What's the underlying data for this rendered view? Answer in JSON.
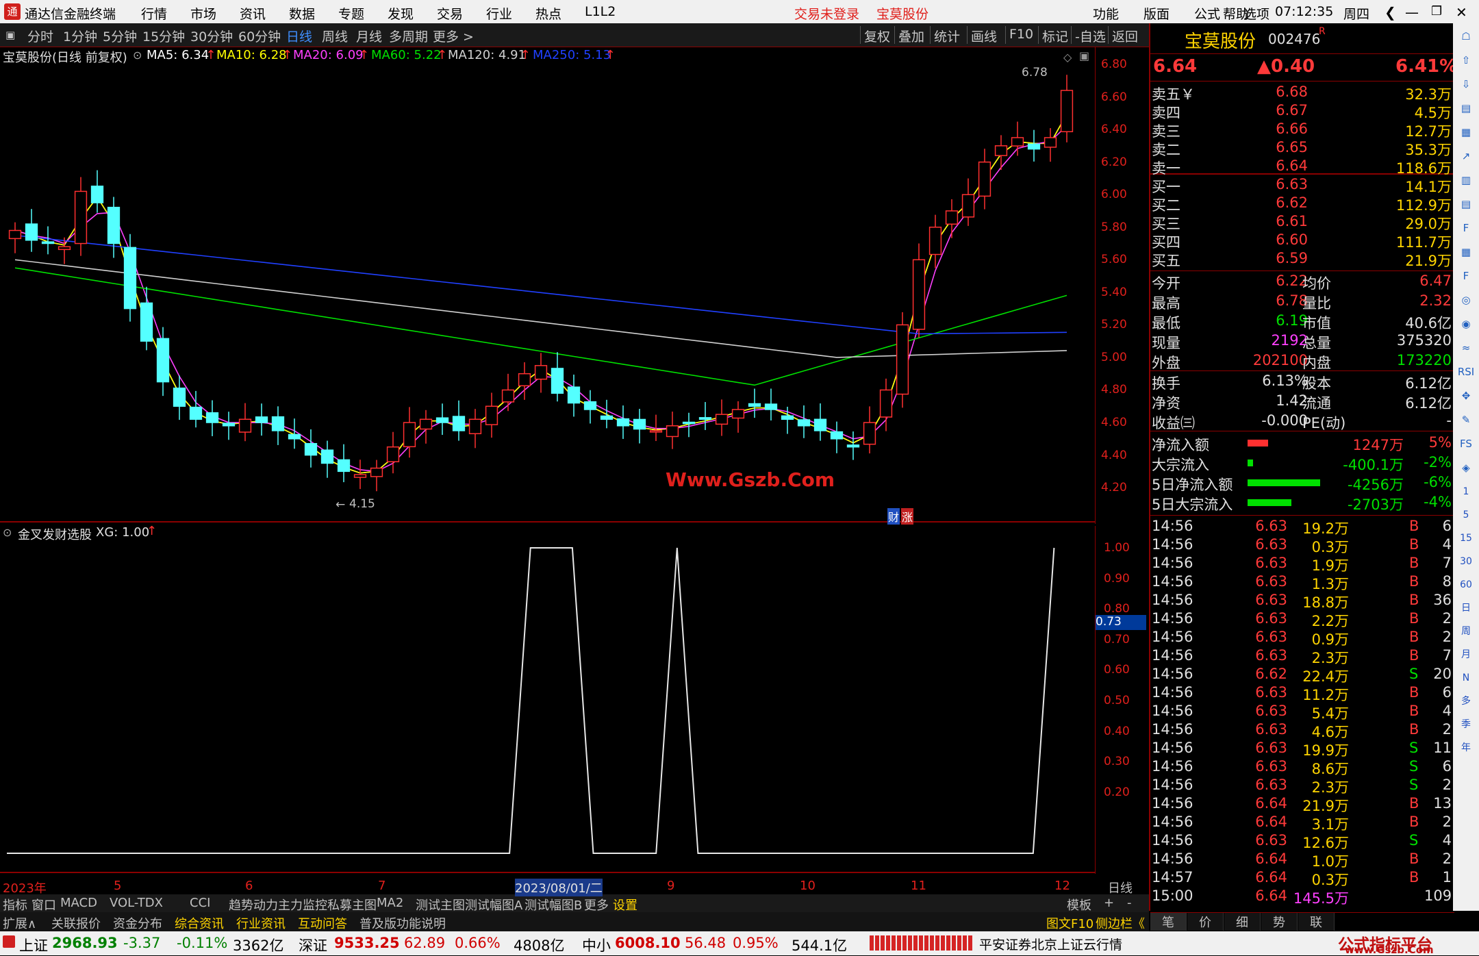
{
  "app": {
    "logo_text": "通",
    "title": "通达信金融终端"
  },
  "menu": [
    "行情",
    "市场",
    "资讯",
    "数据",
    "专题",
    "发现",
    "交易",
    "行业",
    "热点",
    "L1L2"
  ],
  "login_status": "交易未登录",
  "header_stock": "宝莫股份",
  "right_menu": [
    "功能",
    "版面",
    "公式",
    "选项",
    "帮助"
  ],
  "clock": "07:12:35",
  "weekday": "周四",
  "toolbar": {
    "periods": [
      "分时",
      "1分钟",
      "5分钟",
      "15分钟",
      "30分钟",
      "60分钟",
      "日线",
      "周线",
      "月线",
      "多周期",
      "更多 >"
    ],
    "active": "日线",
    "right": [
      "复权",
      "叠加",
      "统计",
      "画线",
      "F10",
      "标记",
      "-自选",
      "返回"
    ]
  },
  "chart_header": {
    "name": "宝莫股份(日线 前复权)",
    "ma": [
      {
        "label": "MA5: 6.34",
        "color": "#ffffff"
      },
      {
        "label": "MA10: 6.28",
        "color": "#ffff00"
      },
      {
        "label": "MA20: 6.09",
        "color": "#ff40ff"
      },
      {
        "label": "MA60: 5.22",
        "color": "#00e000"
      },
      {
        "label": "MA120: 4.91",
        "color": "#d0d0d0"
      },
      {
        "label": "MA250: 5.13",
        "color": "#2040ff"
      }
    ]
  },
  "price_axis": [
    "6.80",
    "6.60",
    "6.40",
    "6.20",
    "6.00",
    "5.80",
    "5.60",
    "5.40",
    "5.20",
    "5.00",
    "4.80",
    "4.60",
    "4.40",
    "4.20"
  ],
  "high_label": "6.78",
  "low_label": "4.15",
  "watermark": "Www.Gszb.Com",
  "badge": {
    "a": "财",
    "b": "涨"
  },
  "indicator": {
    "name": "金叉发财选股",
    "value": "XG: 1.00"
  },
  "indicator_axis": [
    "1.00",
    "0.90",
    "0.80",
    "0.70",
    "0.60",
    "0.50",
    "0.40",
    "0.30",
    "0.20"
  ],
  "cursor_value": "0.73",
  "date_axis": [
    "2023年",
    "5",
    "6",
    "7",
    "2023/08/01/二",
    "9",
    "10",
    "11",
    "12"
  ],
  "period_label": "日线",
  "chart_data": {
    "type": "line",
    "candles_note": "daily candlestick, 宝莫股份 002476",
    "price_range": [
      4.15,
      6.78
    ],
    "close_samples": [
      5.78,
      5.72,
      5.7,
      5.68,
      6.02,
      5.95,
      5.7,
      5.3,
      5.1,
      4.85,
      4.7,
      4.62,
      4.6,
      4.58,
      4.62,
      4.6,
      4.55,
      4.5,
      4.4,
      4.35,
      4.3,
      4.28,
      4.32,
      4.45,
      4.6,
      4.62,
      4.6,
      4.55,
      4.62,
      4.7,
      4.8,
      4.9,
      4.95,
      4.78,
      4.72,
      4.68,
      4.62,
      4.58,
      4.56,
      4.55,
      4.58,
      4.6,
      4.62,
      4.65,
      4.68,
      4.7,
      4.68,
      4.62,
      4.58,
      4.55,
      4.5,
      4.45,
      4.6,
      4.8,
      5.2,
      5.6,
      5.8,
      5.9,
      6.0,
      6.2,
      6.3,
      6.35,
      6.28,
      6.35,
      6.64
    ],
    "indicator_xg": [
      0,
      0,
      0,
      0,
      0,
      0,
      0,
      0,
      0,
      0,
      0,
      0,
      0,
      0,
      0,
      0,
      0,
      0,
      0,
      0,
      0,
      0,
      0,
      0,
      0,
      1,
      1,
      1,
      0,
      0,
      0,
      0,
      1,
      0,
      0,
      0,
      0,
      0,
      0,
      0,
      0,
      0,
      0,
      0,
      0,
      0,
      0,
      0,
      0,
      0,
      1
    ],
    "ylim_indicator": [
      0,
      1
    ]
  },
  "quote": {
    "name": "宝莫股份",
    "code": "002476",
    "flag": "R",
    "price": "6.64",
    "change": "▲0.40",
    "pct": "6.41%",
    "sells": [
      {
        "label": "卖五￥",
        "price": "6.68",
        "vol": "32.3万"
      },
      {
        "label": "卖四",
        "price": "6.67",
        "vol": "4.5万"
      },
      {
        "label": "卖三",
        "price": "6.66",
        "vol": "12.7万"
      },
      {
        "label": "卖二",
        "price": "6.65",
        "vol": "35.3万"
      },
      {
        "label": "卖一",
        "price": "6.64",
        "vol": "118.6万"
      }
    ],
    "buys": [
      {
        "label": "买一",
        "price": "6.63",
        "vol": "14.1万"
      },
      {
        "label": "买二",
        "price": "6.62",
        "vol": "112.9万"
      },
      {
        "label": "买三",
        "price": "6.61",
        "vol": "29.0万"
      },
      {
        "label": "买四",
        "price": "6.60",
        "vol": "111.7万"
      },
      {
        "label": "买五",
        "price": "6.59",
        "vol": "21.9万"
      }
    ],
    "stats": [
      {
        "l1": "今开",
        "v1": "6.22",
        "c1": "red",
        "l2": "均价",
        "v2": "6.47",
        "c2": "red"
      },
      {
        "l1": "最高",
        "v1": "6.78",
        "c1": "red",
        "l2": "量比",
        "v2": "2.32",
        "c2": "red"
      },
      {
        "l1": "最低",
        "v1": "6.19",
        "c1": "grn",
        "l2": "市值",
        "v2": "40.6亿",
        "c2": "wht"
      },
      {
        "l1": "现量",
        "v1": "2192",
        "c1": "mag",
        "l2": "总量",
        "v2": "375320",
        "c2": "wht"
      },
      {
        "l1": "外盘",
        "v1": "202100",
        "c1": "red",
        "l2": "内盘",
        "v2": "173220",
        "c2": "grn"
      }
    ],
    "stats2": [
      {
        "l1": "换手",
        "v1": "6.13%",
        "l2": "股本",
        "v2": "6.12亿"
      },
      {
        "l1": "净资",
        "v1": "1.42",
        "l2": "流通",
        "v2": "6.12亿"
      },
      {
        "l1": "收益㈢",
        "v1": "-0.000",
        "l2": "PE(动)",
        "v2": "-"
      }
    ],
    "flows": [
      {
        "label": "净流入额",
        "bar": "red",
        "barw": 0.28,
        "val": "1247万",
        "pct": "5%",
        "color": "red"
      },
      {
        "label": "大宗流入",
        "bar": "grn",
        "barw": 0.08,
        "val": "-400.1万",
        "pct": "-2%",
        "color": "grn"
      },
      {
        "label": "5日净流入额",
        "bar": "grn",
        "barw": 1.0,
        "val": "-4256万",
        "pct": "-6%",
        "color": "grn"
      },
      {
        "label": "5日大宗流入",
        "bar": "grn",
        "barw": 0.6,
        "val": "-2703万",
        "pct": "-4%",
        "color": "grn"
      }
    ],
    "trades": [
      {
        "t": "14:56",
        "p": "6.63",
        "v": "19.2万",
        "bs": "B",
        "n": "6"
      },
      {
        "t": "14:56",
        "p": "6.63",
        "v": "0.3万",
        "bs": "B",
        "n": "4"
      },
      {
        "t": "14:56",
        "p": "6.63",
        "v": "1.9万",
        "bs": "B",
        "n": "7"
      },
      {
        "t": "14:56",
        "p": "6.63",
        "v": "1.3万",
        "bs": "B",
        "n": "8"
      },
      {
        "t": "14:56",
        "p": "6.63",
        "v": "18.8万",
        "bs": "B",
        "n": "36"
      },
      {
        "t": "14:56",
        "p": "6.63",
        "v": "2.2万",
        "bs": "B",
        "n": "2"
      },
      {
        "t": "14:56",
        "p": "6.63",
        "v": "0.9万",
        "bs": "B",
        "n": "2"
      },
      {
        "t": "14:56",
        "p": "6.63",
        "v": "2.3万",
        "bs": "B",
        "n": "7"
      },
      {
        "t": "14:56",
        "p": "6.62",
        "v": "22.4万",
        "bs": "S",
        "n": "20"
      },
      {
        "t": "14:56",
        "p": "6.63",
        "v": "11.2万",
        "bs": "B",
        "n": "6"
      },
      {
        "t": "14:56",
        "p": "6.63",
        "v": "5.4万",
        "bs": "B",
        "n": "4"
      },
      {
        "t": "14:56",
        "p": "6.63",
        "v": "4.6万",
        "bs": "B",
        "n": "2"
      },
      {
        "t": "14:56",
        "p": "6.63",
        "v": "19.9万",
        "bs": "S",
        "n": "11"
      },
      {
        "t": "14:56",
        "p": "6.63",
        "v": "8.6万",
        "bs": "S",
        "n": "6"
      },
      {
        "t": "14:56",
        "p": "6.63",
        "v": "2.3万",
        "bs": "S",
        "n": "2"
      },
      {
        "t": "14:56",
        "p": "6.64",
        "v": "21.9万",
        "bs": "B",
        "n": "13"
      },
      {
        "t": "14:56",
        "p": "6.64",
        "v": "3.1万",
        "bs": "B",
        "n": "2"
      },
      {
        "t": "14:56",
        "p": "6.63",
        "v": "12.6万",
        "bs": "S",
        "n": "4"
      },
      {
        "t": "14:56",
        "p": "6.64",
        "v": "1.0万",
        "bs": "B",
        "n": "2"
      },
      {
        "t": "14:57",
        "p": "6.64",
        "v": "0.3万",
        "bs": "B",
        "n": "1"
      },
      {
        "t": "15:00",
        "p": "6.64",
        "v": "145.5万",
        "bs": "",
        "n": "109"
      }
    ],
    "bottom_tabs": [
      "笔",
      "价",
      "细",
      "势",
      "联"
    ]
  },
  "sidebar_icons": [
    "☖",
    "⇧",
    "⇩",
    "▤",
    "▦",
    "↗",
    "▥",
    "▤",
    "F",
    "▦",
    "F",
    "◎",
    "◉",
    "≈",
    "RSI",
    "✥",
    "✎",
    "FS",
    "◈",
    "1",
    "5",
    "15",
    "30",
    "60",
    "日",
    "周",
    "月",
    "N",
    "多",
    "季",
    "年"
  ],
  "tabs1": [
    "指标",
    "窗口",
    "MACD",
    "VOL-TDX",
    "CCI",
    "趋势动力",
    "主力监控",
    "私募主图",
    "MA2",
    "测试主图",
    "测试幅图A",
    "测试幅图B",
    "更多",
    "设置"
  ],
  "tabs1_right": [
    "模板",
    "+",
    "-"
  ],
  "tabs2": [
    "扩展∧",
    "关联报价",
    "资金分布",
    "综合资讯",
    "行业资讯",
    "互动问答",
    "普及版功能说明"
  ],
  "tabs2_right": [
    "图文F10",
    "侧边栏《"
  ],
  "status": {
    "sh_label": "上证",
    "sh": "2968.93",
    "sh_chg": "-3.37",
    "sh_pct": "-0.11%",
    "sh_amt": "3362亿",
    "sz_label": "深证",
    "sz": "9533.25",
    "sz_chg": "62.89",
    "sz_pct": "0.66%",
    "sz_amt": "4808亿",
    "zx_label": "中小",
    "zx": "6008.10",
    "zx_chg": "56.48",
    "zx_pct": "0.95%",
    "zx_amt": "544.1亿",
    "broker": "平安证券北京上证云行情",
    "brand": "公式指标平台",
    "brand_url": "www.Gszb.Com"
  }
}
